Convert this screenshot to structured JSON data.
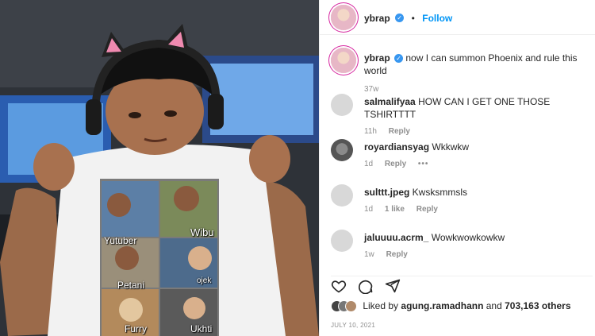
{
  "post": {
    "author": "ybrap",
    "follow_label": "Follow",
    "separator": "•"
  },
  "caption": {
    "username": "ybrap",
    "text": "now I can summon Phoenix and rule this world",
    "age": "37w"
  },
  "shirt": {
    "labels": [
      "Yutuber",
      "Wibu",
      "Petani",
      "ojek",
      "Furry",
      "Ukhti"
    ]
  },
  "comments": [
    {
      "username": "salmalifyaa",
      "text": "HOW CAN I GET ONE THOSE TSHIRTTTT",
      "age": "11h",
      "reply": "Reply"
    },
    {
      "username": "royardiansyag",
      "text": "Wkkwkw",
      "age": "1d",
      "reply": "Reply",
      "more": "•••"
    },
    {
      "username": "sulttt.jpeg",
      "text": "Kwsksmmsls",
      "age": "1d",
      "likes": "1 like",
      "reply": "Reply"
    },
    {
      "username": "jaluuuu.acrm_",
      "text": "Wowkwowkowkw",
      "age": "1w",
      "reply": "Reply"
    }
  ],
  "likes": {
    "prefix": "Liked by",
    "first_user": "agung.ramadhann",
    "and": "and",
    "others": "703,163 others"
  },
  "date": "JULY 10, 2021",
  "colors": {
    "accent": "#0095f6",
    "verified": "#3897f0",
    "muted": "#8e8e8e"
  },
  "icons": [
    "heart-icon",
    "comment-icon",
    "share-icon",
    "verified-icon"
  ]
}
